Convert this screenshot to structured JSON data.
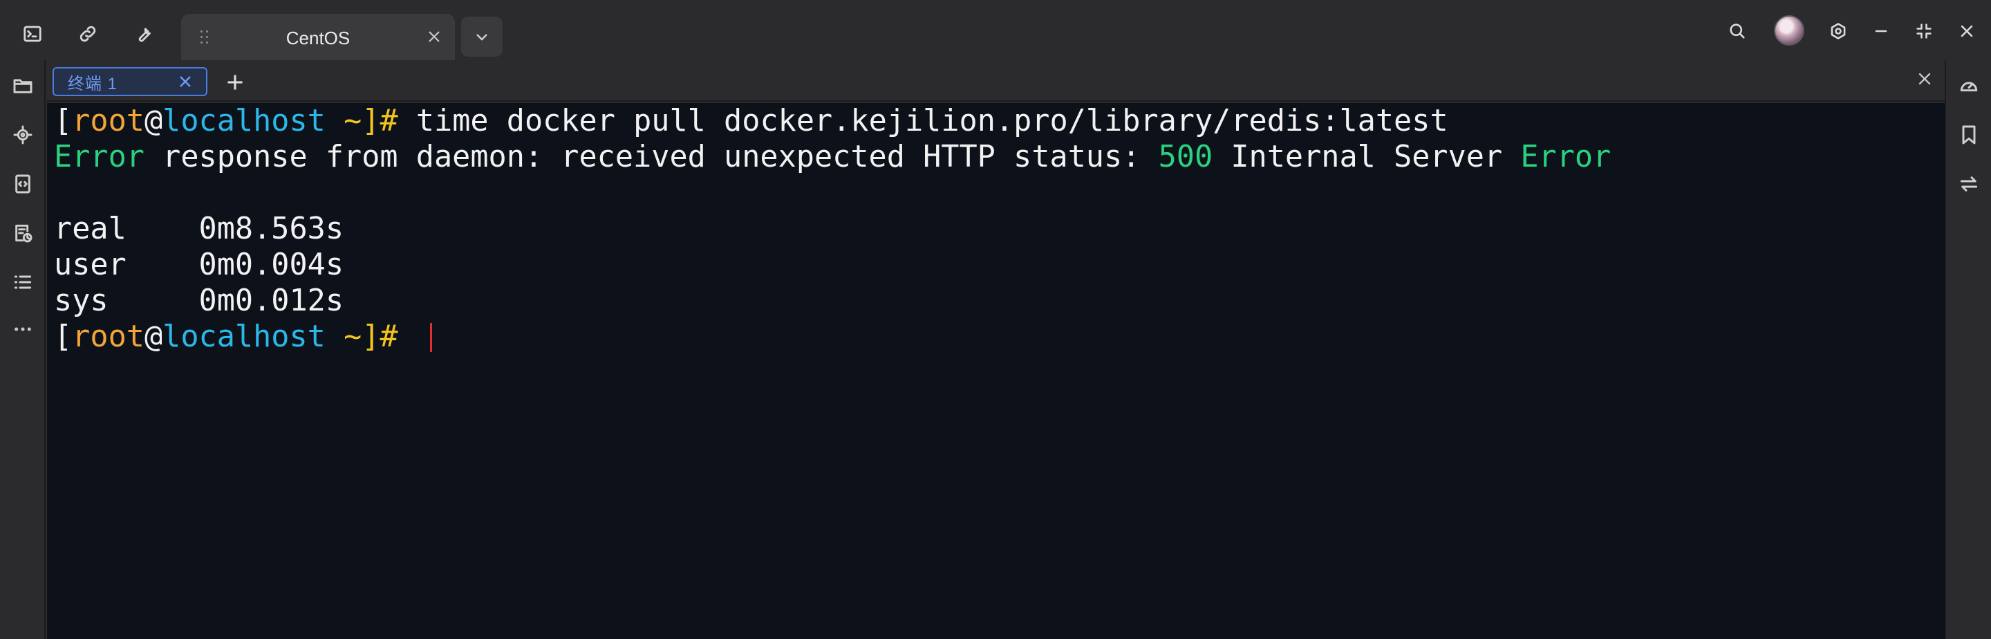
{
  "titlebar": {
    "tab_title": "CentOS",
    "icons": [
      "terminal-icon",
      "link-icon",
      "wrench-icon",
      "drag-grip-icon",
      "close-icon",
      "chevron-down-icon",
      "search-icon",
      "avatar",
      "settings-icon",
      "minimize-icon",
      "restore-icon",
      "close-window-icon"
    ]
  },
  "leftbar": {
    "icons": [
      "folder-icon",
      "target-icon",
      "code-file-icon",
      "file-history-icon",
      "list-icon",
      "more-icon"
    ]
  },
  "rightbar": {
    "icons": [
      "speedometer-icon",
      "bookmark-icon",
      "swap-icon"
    ]
  },
  "terminal_tabs": [
    {
      "label": "终端  1"
    }
  ],
  "terminal": {
    "prompt": {
      "open": "[",
      "user": "root",
      "at": "@",
      "host": "localhost",
      "path": " ~]",
      "hash": "# "
    },
    "command": "time docker pull docker.kejilion.pro/library/redis:latest",
    "error_line": {
      "w1": "Error",
      "t1": " response from daemon: received unexpected HTTP status: ",
      "code": "500",
      "t2": " Internal Server ",
      "w2": "Error"
    },
    "timing": [
      {
        "text": "real    0m8.563s"
      },
      {
        "text": "user    0m0.004s"
      },
      {
        "text": "sys     0m0.012s"
      }
    ]
  },
  "colors": {
    "user": "#f3a537",
    "host": "#2bb7e8",
    "prompt_symbol": "#f4c520",
    "highlight": "#2ad17f",
    "cursor": "#e22e2e",
    "terminal_bg": "#0d111a"
  }
}
